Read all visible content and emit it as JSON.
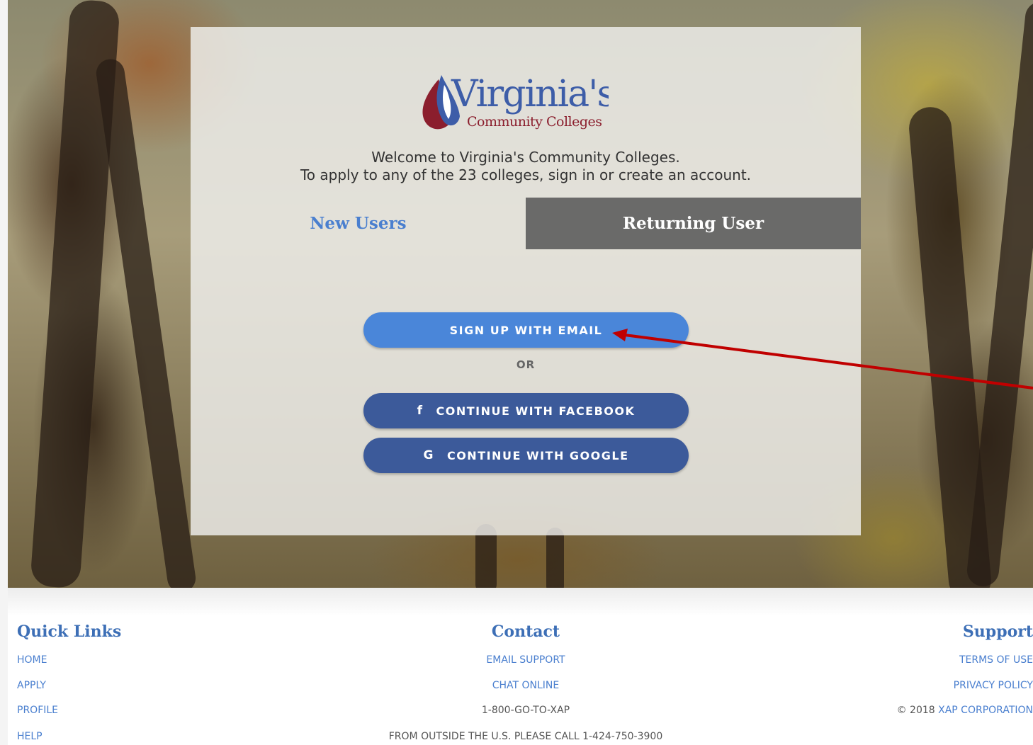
{
  "brand": {
    "logo_main": "Virginia's",
    "logo_sub": "Community Colleges"
  },
  "welcome": {
    "line1": "Welcome to Virginia's Community Colleges.",
    "line2": "To apply to any of the 23 colleges, sign in or create an account."
  },
  "tabs": {
    "new_users": "New Users",
    "returning_user": "Returning User",
    "active": "new_users"
  },
  "actions": {
    "sign_up_email": "SIGN UP WITH EMAIL",
    "or": "OR",
    "facebook": "CONTINUE WITH FACEBOOK",
    "google": "CONTINUE WITH GOOGLE"
  },
  "icons": {
    "facebook": "facebook-icon",
    "google": "google-icon",
    "annotation": "red-arrow-annotation"
  },
  "footer": {
    "quick_links": {
      "title": "Quick Links",
      "items": [
        "HOME",
        "APPLY",
        "PROFILE",
        "HELP"
      ]
    },
    "contact": {
      "title": "Contact",
      "email_support": "EMAIL SUPPORT",
      "chat_online": "CHAT ONLINE",
      "phone": "1-800-GO-TO-XAP",
      "outside_us": "FROM OUTSIDE THE U.S. PLEASE CALL 1-424-750-3900"
    },
    "support": {
      "title": "Support",
      "terms": "TERMS OF USE",
      "privacy": "PRIVACY POLICY",
      "copyright_prefix": "© 2018 ",
      "copyright_link": "XAP CORPORATION"
    }
  },
  "colors": {
    "accent_blue": "#4a86d9",
    "facebook_blue": "#3c5a9a",
    "link_blue": "#4a7fcf",
    "logo_red": "#8b1e2d",
    "arrow_red": "#c00000"
  }
}
